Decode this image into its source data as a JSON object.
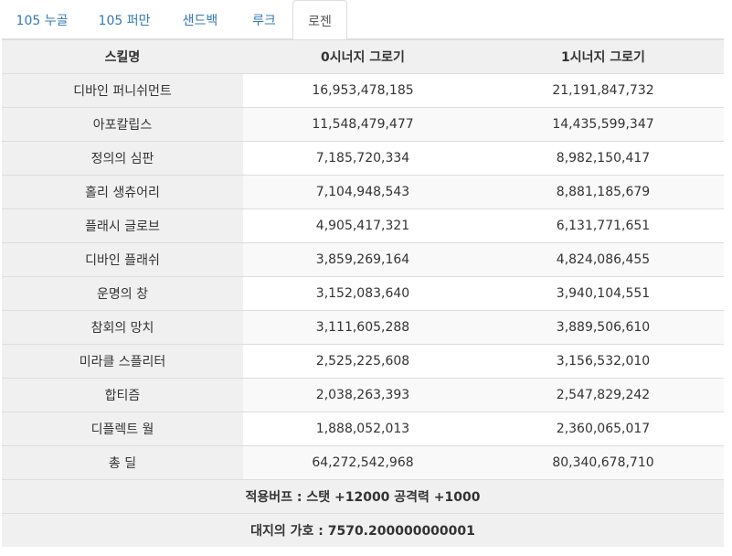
{
  "tabs": [
    {
      "label": "105 누골",
      "active": false
    },
    {
      "label": "105 퍼만",
      "active": false
    },
    {
      "label": "샌드백",
      "active": false
    },
    {
      "label": "루크",
      "active": false
    },
    {
      "label": "로젠",
      "active": true
    }
  ],
  "table": {
    "headers": [
      "스킬명",
      "0시너지 그로기",
      "1시너지 그로기"
    ],
    "rows": [
      {
        "name": "디바인 퍼니쉬먼트",
        "a": "16,953,478,185",
        "b": "21,191,847,732"
      },
      {
        "name": "아포칼립스",
        "a": "11,548,479,477",
        "b": "14,435,599,347"
      },
      {
        "name": "정의의 심판",
        "a": "7,185,720,334",
        "b": "8,982,150,417"
      },
      {
        "name": "홀리 생츄어리",
        "a": "7,104,948,543",
        "b": "8,881,185,679"
      },
      {
        "name": "플래시 글로브",
        "a": "4,905,417,321",
        "b": "6,131,771,651"
      },
      {
        "name": "디바인 플래쉬",
        "a": "3,859,269,164",
        "b": "4,824,086,455"
      },
      {
        "name": "운명의 창",
        "a": "3,152,083,640",
        "b": "3,940,104,551"
      },
      {
        "name": "참회의 망치",
        "a": "3,111,605,288",
        "b": "3,889,506,610"
      },
      {
        "name": "미라클 스플리터",
        "a": "2,525,225,608",
        "b": "3,156,532,010"
      },
      {
        "name": "합티즘",
        "a": "2,038,263,393",
        "b": "2,547,829,242"
      },
      {
        "name": "디플렉트 월",
        "a": "1,888,052,013",
        "b": "2,360,065,017"
      },
      {
        "name": "총 딜",
        "a": "64,272,542,968",
        "b": "80,340,678,710"
      }
    ],
    "footer": [
      "적용버프 : 스탯 +12000 공격력 +1000",
      "대지의 가호 : 7570.200000000001"
    ]
  }
}
